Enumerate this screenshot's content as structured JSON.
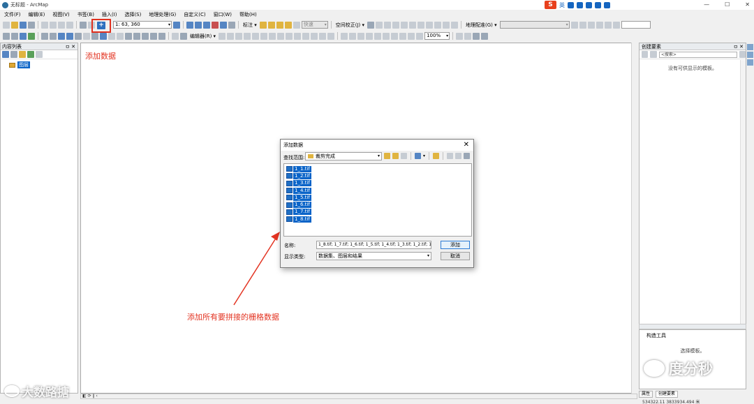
{
  "window": {
    "title": "无标题 - ArcMap",
    "min": "—",
    "max": "☐",
    "close": "✕"
  },
  "ime": {
    "badge": "S",
    "lang": "英"
  },
  "menu": [
    "文件(F)",
    "编辑(E)",
    "视图(V)",
    "书签(B)",
    "插入(I)",
    "选择(S)",
    "地理处理(G)",
    "自定义(C)",
    "窗口(W)",
    "帮助(H)"
  ],
  "toolbar1": {
    "scale": "1: 63, 360",
    "label_markup": "标注 ▾",
    "quick_combo": "快速",
    "spatial_adjust": "空间校正(J) ▾",
    "georef": "地理配准(G) ▾"
  },
  "toolbar2": {
    "editor": "编辑器(R) ▾",
    "zoom": "100%"
  },
  "toc": {
    "title": "内容列表",
    "pin": "ㅁ ✕",
    "layer": "图层"
  },
  "annotations": {
    "add_data": "添加数据",
    "add_rasters": "添加所有要拼接的栅格数据"
  },
  "dialog": {
    "title": "添加数据",
    "close": "✕",
    "lookin_label": "查找范围:",
    "lookin_value": "裁剪完成",
    "files": [
      "1_1.tif",
      "1_2.tif",
      "1_3.tif",
      "1_4.tif",
      "1_5.tif",
      "1_6.tif",
      "1_7.tif",
      "1_8.tif"
    ],
    "name_label": "名称:",
    "name_value": "1_8.tif; 1_7.tif; 1_6.tif; 1_5.tif; 1_4.tif; 1_3.tif; 1_2.tif; 1_",
    "type_label": "显示类型:",
    "type_value": "数据集、图层和结果",
    "add_button": "添加",
    "cancel_button": "取消"
  },
  "create_features": {
    "title": "创建要素",
    "pin": "ㅁ ✕",
    "search_placeholder": "<搜索>",
    "empty_msg": "没有可供显示的模板。",
    "tool_title": "构造工具",
    "tool_msg": "选择模板。",
    "tab_properties": "属性",
    "tab_create": "创建要素"
  },
  "status": {
    "coords": "534322.11  3833934.494 米"
  },
  "watermarks": {
    "left": "大数路搪",
    "right": "度分秒"
  },
  "colors": {
    "annotation": "#e33422",
    "selection": "#0a64c8",
    "highlight_box": "#e0301e"
  }
}
